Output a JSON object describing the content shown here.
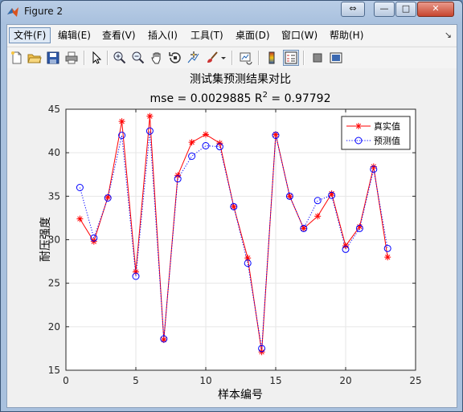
{
  "window": {
    "title": "Figure 2",
    "controls": {
      "restore": "⇔",
      "minimize": "—",
      "maximize": "□",
      "close": "✕"
    }
  },
  "menu": {
    "items": [
      "文件(F)",
      "编辑(E)",
      "查看(V)",
      "插入(I)",
      "工具(T)",
      "桌面(D)",
      "窗口(W)",
      "帮助(H)"
    ],
    "overflow": "↘"
  },
  "toolbar": {
    "buttons": [
      "new-figure",
      "open-file",
      "save",
      "print",
      "select-arrow",
      "zoom-in",
      "zoom-out",
      "pan",
      "rotate-3d",
      "data-cursor",
      "brush",
      "brush-dropdown",
      "link-plot",
      "insert-colorbar",
      "insert-legend",
      "hide-plot-tools",
      "show-plot-tools"
    ],
    "pressed": "insert-legend"
  },
  "chart_data": {
    "type": "line",
    "title": "测试集预测结果对比",
    "subtitle": {
      "prefix": "mse = 0.0029885 R",
      "sup": "2",
      "suffix": " = 0.97792"
    },
    "xlabel": "样本编号",
    "ylabel": "耐压强度",
    "xlim": [
      0,
      25
    ],
    "ylim": [
      15,
      45
    ],
    "xticks": [
      0,
      5,
      10,
      15,
      20,
      25
    ],
    "yticks": [
      15,
      20,
      25,
      30,
      35,
      40,
      45
    ],
    "grid": true,
    "legend_position": "top-right",
    "x": [
      1,
      2,
      3,
      4,
      5,
      6,
      7,
      8,
      9,
      10,
      11,
      12,
      13,
      14,
      15,
      16,
      17,
      18,
      19,
      20,
      21,
      22,
      23
    ],
    "series": [
      {
        "name": "真实值",
        "color": "#ff0000",
        "style": "solid",
        "marker": "asterisk",
        "values": [
          32.4,
          29.8,
          34.9,
          43.6,
          26.3,
          44.2,
          18.5,
          37.4,
          41.2,
          42.1,
          41.1,
          33.8,
          27.9,
          17.1,
          42.1,
          35.0,
          31.3,
          32.7,
          35.3,
          29.3,
          31.5,
          38.4,
          28.0
        ]
      },
      {
        "name": "预测值",
        "color": "#0000ff",
        "style": "dotted",
        "marker": "circle",
        "values": [
          36.0,
          30.2,
          34.8,
          42.0,
          25.8,
          42.5,
          18.6,
          37.0,
          39.6,
          40.8,
          40.7,
          33.8,
          27.3,
          17.5,
          42.0,
          35.0,
          31.3,
          34.5,
          35.1,
          28.9,
          31.3,
          38.1,
          29.0
        ]
      }
    ]
  }
}
